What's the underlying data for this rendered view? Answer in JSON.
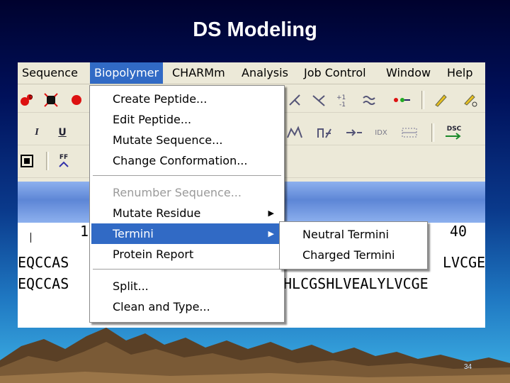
{
  "slide": {
    "title": "DS Modeling",
    "page_number": "34"
  },
  "menubar": {
    "items": [
      "Sequence",
      "Biopolymer",
      "CHARMm",
      "Analysis",
      "Job Control",
      "Window",
      "Help"
    ],
    "active": "Biopolymer"
  },
  "toolbar": {
    "icons": [
      "atom-color-icon",
      "select-icon",
      "italic-icon",
      "underline-icon",
      "force-field-icon",
      "view-icon"
    ],
    "labels": {
      "italic": "I",
      "underline": "U",
      "ff": "FF",
      "dsc": "DSC",
      "idx": "IDX"
    }
  },
  "biopolymer_menu": {
    "items": [
      {
        "label": "Create Peptide...",
        "disabled": false,
        "submenu": false
      },
      {
        "label": "Edit Peptide...",
        "disabled": false,
        "submenu": false
      },
      {
        "label": "Mutate Sequence...",
        "disabled": false,
        "submenu": false
      },
      {
        "label": "Change Conformation...",
        "disabled": false,
        "submenu": false
      },
      {
        "label": "Renumber Sequence...",
        "disabled": true,
        "submenu": false
      },
      {
        "label": "Mutate Residue",
        "disabled": false,
        "submenu": true
      },
      {
        "label": "Termini",
        "disabled": false,
        "submenu": true,
        "highlighted": true
      },
      {
        "label": "Protein Report",
        "disabled": false,
        "submenu": false
      },
      {
        "label": "Split...",
        "disabled": false,
        "submenu": false
      },
      {
        "label": "Clean and Type...",
        "disabled": false,
        "submenu": false
      }
    ]
  },
  "termini_submenu": {
    "items": [
      "Neutral Termini",
      "Charged Termini"
    ]
  },
  "sequence_view": {
    "ruler_left": "1",
    "ruler_right": "40",
    "rows_left": [
      "EQCCAS",
      "EQCCAS"
    ],
    "rows_right": [
      "LVCGE",
      "HLCGSHLVEALYLVCGE"
    ]
  },
  "colors": {
    "highlight": "#316ac5",
    "menu_bg": "#ece9d8"
  }
}
